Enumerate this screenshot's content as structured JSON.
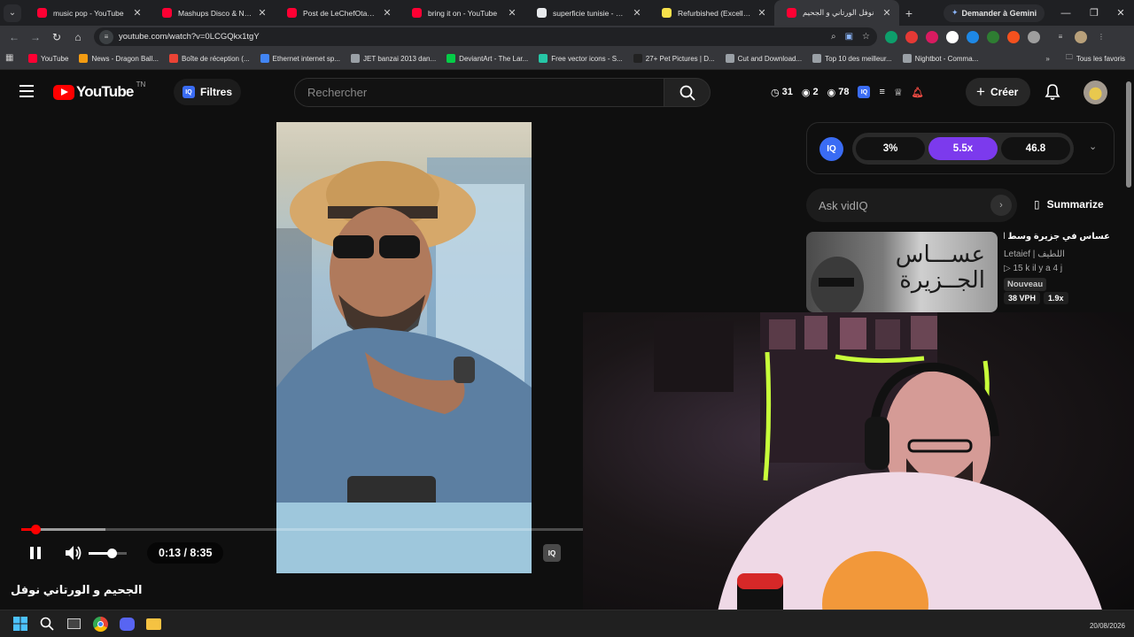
{
  "browser": {
    "tabs": [
      {
        "title": "music pop - YouTube",
        "favicon": "youtube-icon",
        "color": "#ff0033"
      },
      {
        "title": "Mashups Disco & Nu Disco",
        "favicon": "youtube-icon",
        "color": "#ff0033"
      },
      {
        "title": "Post de LeChefOtaku - YouTube",
        "favicon": "youtube-icon",
        "color": "#ff0033"
      },
      {
        "title": "bring it on - YouTube",
        "favicon": "youtube-icon",
        "color": "#ff0033"
      },
      {
        "title": "superficie tunisie - Recherche",
        "favicon": "google-icon",
        "color": "#e8eaed"
      },
      {
        "title": "Refurbished (Excellent) - G",
        "favicon": "shop-icon",
        "color": "#f7e14b"
      },
      {
        "title": "نوفل الورتاني و الجحيم",
        "favicon": "youtube-icon",
        "color": "#ff0033",
        "active": true
      }
    ],
    "gemini_label": "Demander à Gemini",
    "url": "youtube.com/watch?v=0LCGQkx1tgY",
    "bookmarks": [
      {
        "label": "YouTube",
        "color": "#ff0033"
      },
      {
        "label": "News - Dragon Ball...",
        "color": "#f39c12"
      },
      {
        "label": "Boîte de réception (...",
        "color": "#ea4335"
      },
      {
        "label": "Ethernet internet sp...",
        "color": "#4285f4"
      },
      {
        "label": "JET banzai 2013 dan...",
        "color": "#9aa0a6"
      },
      {
        "label": "DeviantArt - The Lar...",
        "color": "#05cc47"
      },
      {
        "label": "Free vector icons - S...",
        "color": "#26c6a6"
      },
      {
        "label": "27+ Pet Pictures | D...",
        "color": "#222222"
      },
      {
        "label": "Cut and Download...",
        "color": "#9aa0a6"
      },
      {
        "label": "Top 10 des meilleur...",
        "color": "#9aa0a6"
      },
      {
        "label": "Nightbot - Comma...",
        "color": "#9aa0a6"
      }
    ],
    "all_bookmarks": "Tous les favoris"
  },
  "youtube": {
    "logo_word": "YouTube",
    "country": "TN",
    "filtres": "Filtres",
    "search_placeholder": "Rechercher",
    "stats": {
      "watch": "31",
      "views_a": "2",
      "views_b": "78"
    },
    "creer": "Créer",
    "player": {
      "time": "0:13 / 8:35",
      "progress_fraction": 0.026,
      "buffer_fraction": 0.15,
      "volume_fraction": 0.6
    },
    "video_title": "الجحيم و الورتاني نوفل"
  },
  "vidiq": {
    "logo": "IQ",
    "pills": [
      "3%",
      "5.5x",
      "46.8"
    ],
    "ask_placeholder": "Ask vidIQ",
    "summarize": "Summarize"
  },
  "recommendation": {
    "title": "عساس في جزيرة وسط البحر...",
    "thumb_text": "عســـاس الجــزيرة",
    "channel": "Letaief | اللطيف",
    "meta": "▷ 15 k  il y a 4 j",
    "badge": "Nouveau",
    "vph": "38 VPH",
    "ratio": "1.9x"
  },
  "taskbar": {
    "date": "20/08/2026"
  },
  "colors": {
    "accent_red": "#ff0000",
    "vidiq_purple": "#7c3aed",
    "vidiq_blue": "#3a6cf4"
  }
}
